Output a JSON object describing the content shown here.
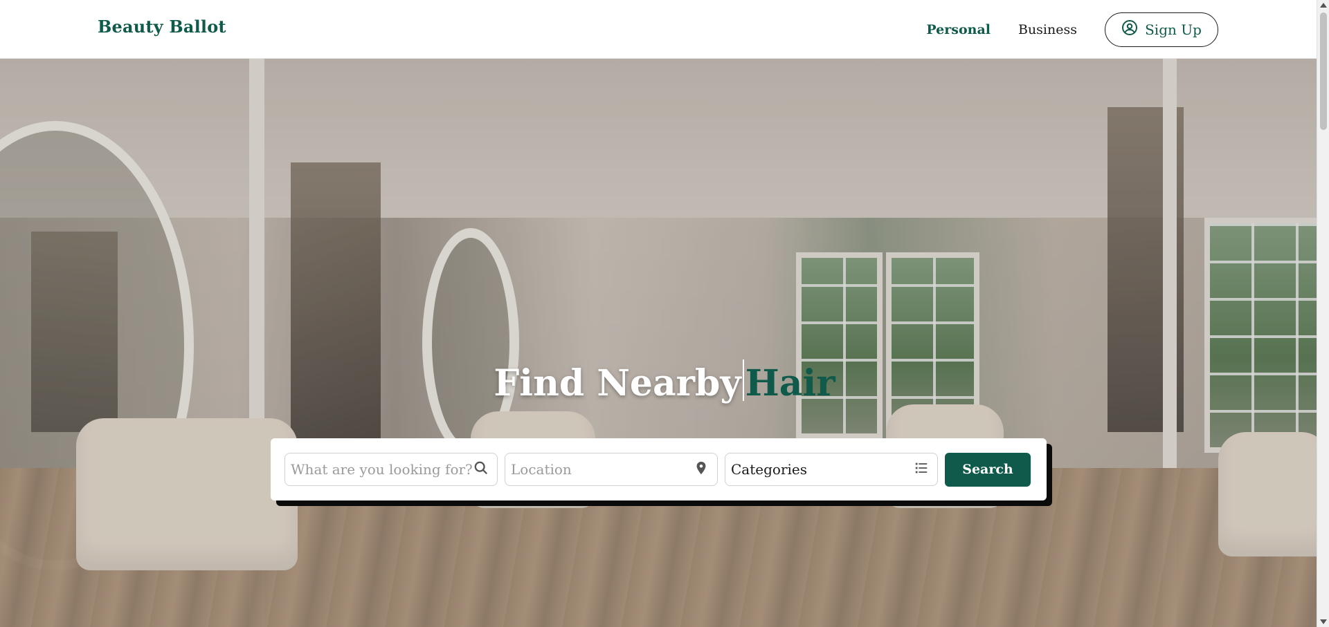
{
  "header": {
    "logo": "Beauty Ballot",
    "nav": {
      "personal": "Personal",
      "business": "Business",
      "signup": "Sign Up"
    }
  },
  "hero": {
    "headline_main": "Find Nearby",
    "headline_accent": "Hair"
  },
  "search": {
    "query_placeholder": "What are you looking for?",
    "location_placeholder": "Location",
    "categories_value": "Categories",
    "button_label": "Search"
  },
  "icons": {
    "signup": "user-circle-icon",
    "query": "search-icon",
    "location": "map-pin-icon",
    "categories": "list-icon"
  },
  "colors": {
    "brand": "#0f5a4a"
  }
}
